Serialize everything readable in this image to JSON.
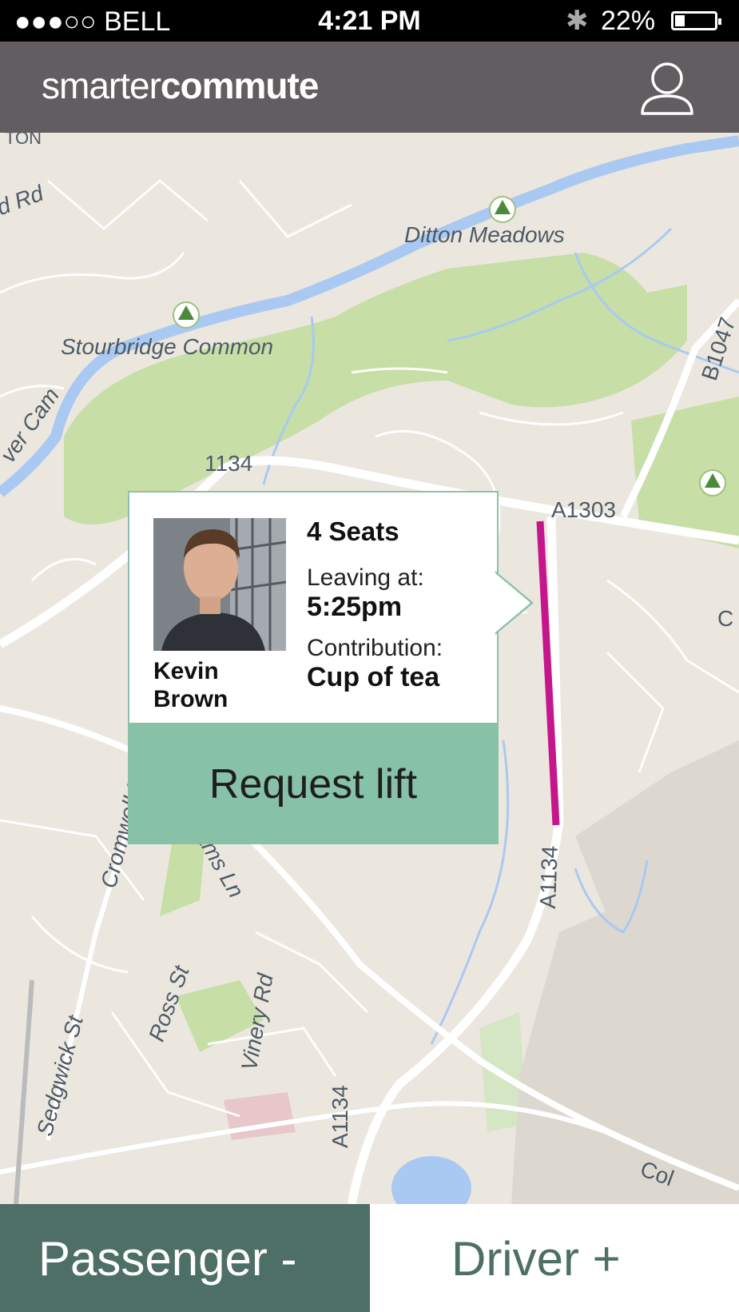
{
  "status_bar": {
    "carrier": "●●●○○ BELL",
    "time": "4:21 PM",
    "battery": "22%"
  },
  "header": {
    "logo_light": "smarter",
    "logo_bold": "commute"
  },
  "map": {
    "labels": {
      "ditton_meadows": "Ditton Meadows",
      "stourbridge_common": "Stourbridge Common",
      "a1303": "A1303",
      "a1134_top": "1134",
      "a1134_bottom": "A1134",
      "a1134_vertical": "A1134",
      "river_cam": "ver Cam",
      "b1047": "B1047",
      "rd_left": "d Rd",
      "ton": "TON",
      "cromwell": "Cromwell R",
      "dhams_ln": "dhams Ln",
      "ross_st": "Ross St",
      "vinery_rd": "Vinery Rd",
      "sedgwick_st": "Sedgwick St",
      "col": "Col",
      "c": "C"
    },
    "route_color": "#c6168d",
    "water_color": "#aac9f2",
    "park_color": "#c7dea6"
  },
  "ride_card": {
    "driver_first": "Kevin",
    "driver_last": "Brown",
    "seats": "4 Seats",
    "leaving_label": "Leaving at:",
    "leaving_time": "5:25pm",
    "contribution_label": "Contribution:",
    "contribution_value": "Cup of tea",
    "request_button": "Request lift"
  },
  "tabs": {
    "passenger": "Passenger -",
    "driver": "Driver +"
  }
}
